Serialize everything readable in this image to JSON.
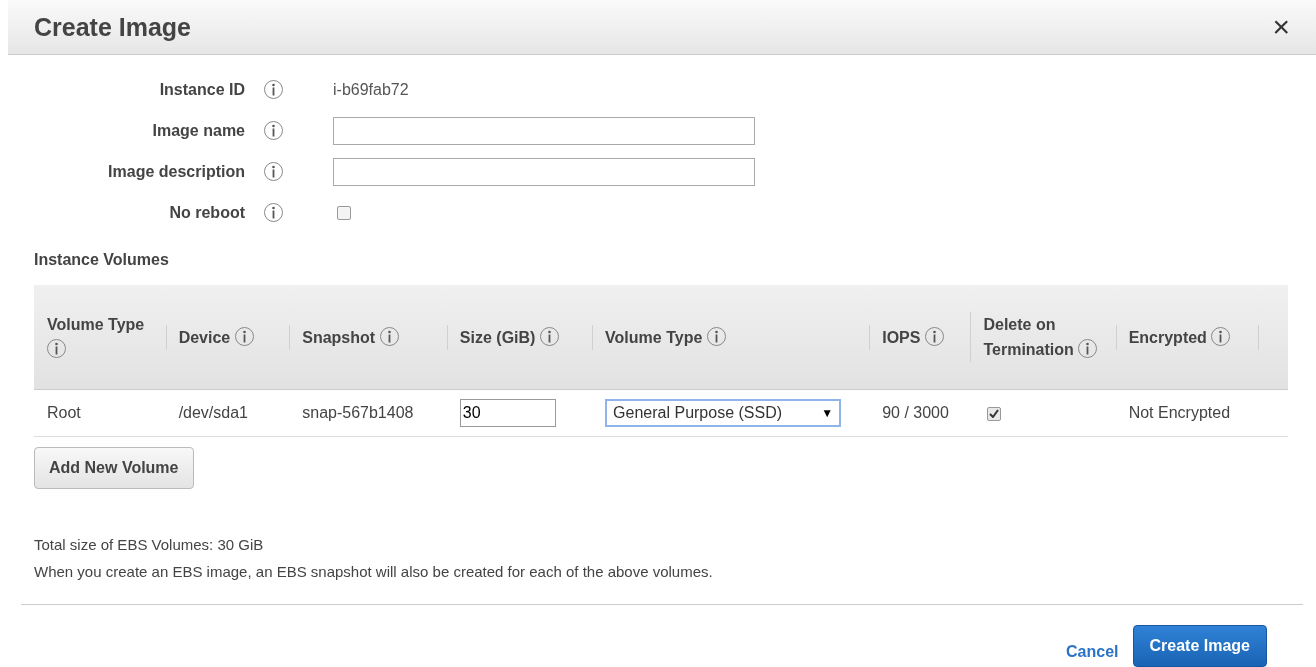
{
  "dialog": {
    "title": "Create Image",
    "close": "×"
  },
  "fields": [
    {
      "label": "Instance ID",
      "kind": "text",
      "value": "i-b69fab72"
    },
    {
      "label": "Image name",
      "kind": "input"
    },
    {
      "label": "Image description",
      "kind": "input"
    },
    {
      "label": "No reboot",
      "kind": "checkbox",
      "checked": false
    }
  ],
  "volumes": {
    "title": "Instance Volumes",
    "columns": [
      "Volume Type",
      "Device",
      "Snapshot",
      "Size (GiB)",
      "Volume Type",
      "IOPS",
      "Delete on Termination",
      "Encrypted"
    ],
    "rows": [
      [
        {
          "kind": "text",
          "value": "Root"
        },
        {
          "kind": "text",
          "value": "/dev/sda1"
        },
        {
          "kind": "text",
          "value": "snap-567b1408"
        },
        {
          "kind": "input",
          "value": "30"
        },
        {
          "kind": "select",
          "value": "General Purpose (SSD)",
          "arrow": "▼"
        },
        {
          "kind": "text",
          "value": "90 / 3000"
        },
        {
          "kind": "checkbox",
          "checked": true
        },
        {
          "kind": "text",
          "value": "Not Encrypted"
        }
      ]
    ],
    "add_button": "Add New Volume"
  },
  "summary": [
    "Total size of EBS Volumes: 30 GiB",
    "When you create an EBS image, an EBS snapshot will also be created for each of the above volumes."
  ],
  "buttons": {
    "cancel": "Cancel",
    "primary": "Create Image"
  }
}
